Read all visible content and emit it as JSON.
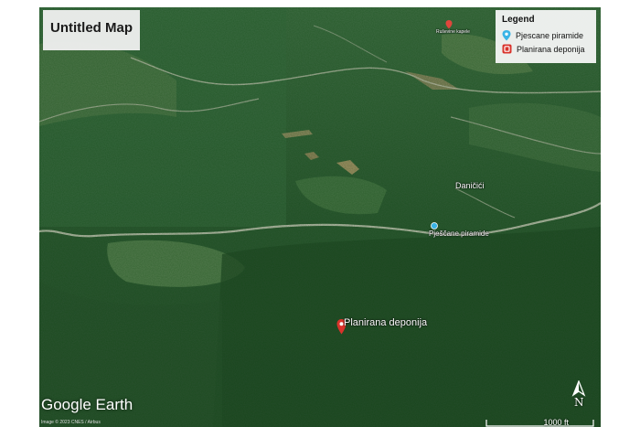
{
  "map": {
    "title": "Untitled Map",
    "legend": {
      "heading": "Legend",
      "items": [
        {
          "label": "Pjescane piramide",
          "icon": "blue-pin-icon",
          "color": "#3ab4e6"
        },
        {
          "label": "Planirana deponija",
          "icon": "red-square-marker-icon",
          "color": "#d9332b"
        }
      ]
    },
    "places": {
      "danicici": "Daničići",
      "pjescane_piramide": "Pješčane piramide",
      "planirana_deponija": "Planirana deponija",
      "top_poi": "Ruševine kapele"
    },
    "branding": "Google Earth",
    "attribution": "Image © 2023 CNES / Airbus",
    "scale_label": "1000 ft",
    "north_label": "N"
  }
}
